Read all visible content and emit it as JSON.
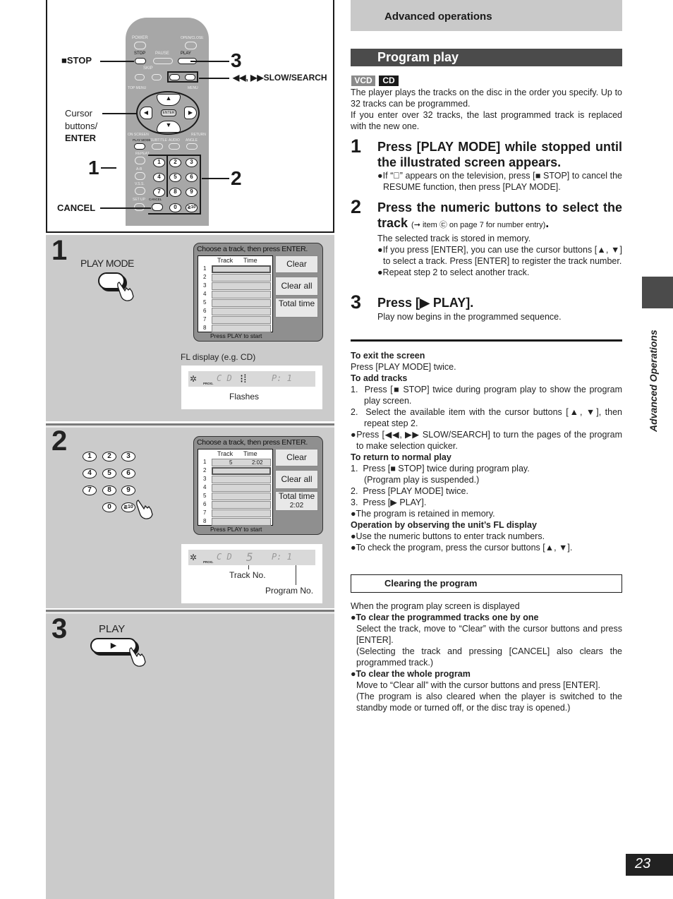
{
  "header": {
    "title": "Advanced operations"
  },
  "section": {
    "title": "Program play"
  },
  "badges": [
    {
      "label": "VCD",
      "color": "#8a8a8a"
    },
    {
      "label": "CD",
      "color": "#1a1a1a"
    }
  ],
  "intro": [
    "The player plays the tracks on the disc in the order you specify. Up to 32 tracks can be programmed.",
    "If you enter over 32 tracks, the last programmed track is replaced with the new one."
  ],
  "steps": [
    {
      "number": "1",
      "heading": "Press [PLAY MODE] while stopped until the illustrated screen appears.",
      "notes": [
        "●If “⃠” appears on the television, press [■ STOP] to cancel the RESUME function, then press [PLAY MODE]."
      ]
    },
    {
      "number": "2",
      "heading": "Press the numeric buttons to select the track",
      "heading_ref": "(➞ item ㉢ on page 7 for number entry)",
      "body": "The selected track is stored in memory.",
      "notes": [
        "●If you press [ENTER], you can use the cursor buttons [▲, ▼] to select a track. Press [ENTER] to register the track number.",
        "●Repeat step 2 to select another track."
      ]
    },
    {
      "number": "3",
      "heading": "Press [▶ PLAY].",
      "body": "Play now begins in the programmed sequence."
    }
  ],
  "notes": {
    "exit": {
      "title": "To exit the screen",
      "text": "Press [PLAY MODE] twice."
    },
    "add": {
      "title": "To add tracks",
      "items": [
        "1.  Press [■ STOP] twice during program play to show the program play screen.",
        "2.  Select the available item with the cursor buttons [▲, ▼], then repeat step 2."
      ],
      "bullet": "●Press [◀◀, ▶▶ SLOW/SEARCH] to turn the pages of the program to make selection quicker."
    },
    "return": {
      "title": "To return to normal play",
      "items": [
        "1.  Press [■ STOP] twice during program play. (Program play is suspended.)",
        "2.  Press [PLAY MODE] twice.",
        "3.  Press [▶ PLAY]."
      ],
      "bullet": "●The program is retained in memory."
    },
    "fl": {
      "title": "Operation by observing the unit’s FL display",
      "bullets": [
        "●Use the numeric buttons to enter track numbers.",
        "●To check the program, press the cursor buttons [▲, ▼]."
      ]
    }
  },
  "clearing": {
    "title": "Clearing the program",
    "intro": "When the program play screen is displayed",
    "one_title": "●To clear the programmed tracks one by one",
    "one_text": "Select the track, move to “Clear” with the cursor buttons and press [ENTER].",
    "one_note": "(Selecting the track and pressing [CANCEL] also clears the programmed track.)",
    "all_title": "●To clear the whole program",
    "all_text": "Move to “Clear all” with the cursor buttons and press [ENTER].",
    "all_note": "(The program is also cleared when the player is switched to the standby mode or turned off, or the disc tray is opened.)"
  },
  "side_tab": {
    "label": "Advanced Operations"
  },
  "page_number": "23",
  "remote": {
    "labels": {
      "power": "POWER",
      "open_close": "OPEN/CLOSE",
      "stop": "STOP",
      "pause": "PAUSE",
      "play": "PLAY",
      "skip": "SKIP",
      "slow_search": "SLOW/ SEARCH",
      "top_menu": "TOP MENU",
      "menu": "MENU",
      "enter": "ENTER",
      "on_screen": "ON SCREEN",
      "play_mode": "PLAY MODE",
      "subtitle": "SUBTITLE",
      "audio": "AUDIO",
      "return": "RETURN",
      "angle": "ANGLE",
      "repeat": "REPEAT",
      "ab": "A-B",
      "vss": "V.S.S.",
      "setup": "SET UP",
      "cancel": "CANCEL"
    },
    "numkeys": [
      "1",
      "2",
      "3",
      "4",
      "5",
      "6",
      "7",
      "8",
      "9",
      "0",
      "≧10"
    ],
    "callouts": {
      "stop": "■STOP",
      "slow_search": "◀◀, ▶▶SLOW/SEARCH",
      "cursor": "Cursor buttons/",
      "enter": "ENTER",
      "cancel": "CANCEL",
      "step1": "1",
      "step2": "2",
      "step3": "3"
    }
  },
  "illustrations": {
    "step1": {
      "button_label": "PLAY MODE",
      "screen": {
        "title": "Choose a track, then press ENTER.",
        "col_track": "Track",
        "col_time": "Time",
        "rows": [
          {
            "n": "1",
            "track": "",
            "time": ""
          },
          {
            "n": "2",
            "track": "",
            "time": ""
          },
          {
            "n": "3",
            "track": "",
            "time": ""
          },
          {
            "n": "4",
            "track": "",
            "time": ""
          },
          {
            "n": "5",
            "track": "",
            "time": ""
          },
          {
            "n": "6",
            "track": "",
            "time": ""
          },
          {
            "n": "7",
            "track": "",
            "time": ""
          },
          {
            "n": "8",
            "track": "",
            "time": ""
          }
        ],
        "selected_row": 1,
        "buttons": [
          "Clear",
          "Clear all",
          "Total time"
        ],
        "total_time": "",
        "footer": "Press PLAY to start"
      },
      "fl_caption": "FL display (e.g. CD)",
      "fl": {
        "prog": "PROG.",
        "disc": "C D",
        "track": "",
        "program": "P:  1"
      },
      "fl_note": "Flashes"
    },
    "step2": {
      "numkeys": [
        "1",
        "2",
        "3",
        "4",
        "5",
        "6",
        "7",
        "8",
        "9",
        "0",
        "≧10"
      ],
      "screen": {
        "title": "Choose a track, then press ENTER.",
        "col_track": "Track",
        "col_time": "Time",
        "rows": [
          {
            "n": "1",
            "track": "5",
            "time": "2:02"
          },
          {
            "n": "2",
            "track": "",
            "time": ""
          },
          {
            "n": "3",
            "track": "",
            "time": ""
          },
          {
            "n": "4",
            "track": "",
            "time": ""
          },
          {
            "n": "5",
            "track": "",
            "time": ""
          },
          {
            "n": "6",
            "track": "",
            "time": ""
          },
          {
            "n": "7",
            "track": "",
            "time": ""
          },
          {
            "n": "8",
            "track": "",
            "time": ""
          }
        ],
        "selected_row": 2,
        "buttons": [
          "Clear",
          "Clear all",
          "Total time"
        ],
        "total_time": "2:02",
        "footer": "Press PLAY to start"
      },
      "fl": {
        "prog": "PROG.",
        "disc": "C D",
        "track": "5",
        "program": "P:  1"
      },
      "fl_track_label": "Track No.",
      "fl_program_label": "Program No."
    },
    "step3": {
      "button_label": "PLAY",
      "glyph": "▶"
    }
  }
}
